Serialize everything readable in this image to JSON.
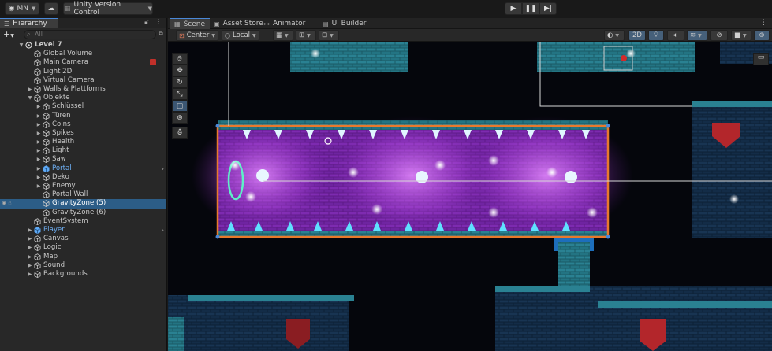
{
  "toolbar": {
    "account": "MN",
    "version_control": "Unity Version Control"
  },
  "hierarchy": {
    "tab_label": "Hierarchy",
    "search_placeholder": "All",
    "items": [
      {
        "label": "Level 7",
        "depth": 0,
        "expanded": true,
        "icon": "unity-scene-icon",
        "bold": true
      },
      {
        "label": "Global Volume",
        "depth": 1,
        "icon": "cube-icon"
      },
      {
        "label": "Main Camera",
        "depth": 1,
        "icon": "cube-icon",
        "badge": "record-icon"
      },
      {
        "label": "Light 2D",
        "depth": 1,
        "icon": "cube-icon"
      },
      {
        "label": "Virtual Camera",
        "depth": 1,
        "icon": "cube-icon"
      },
      {
        "label": "Walls & Plattforms",
        "depth": 1,
        "collapsed": true,
        "icon": "cube-icon"
      },
      {
        "label": "Objekte",
        "depth": 1,
        "expanded": true,
        "icon": "cube-icon"
      },
      {
        "label": "Schlüssel",
        "depth": 2,
        "collapsed": true,
        "icon": "cube-icon"
      },
      {
        "label": "Türen",
        "depth": 2,
        "collapsed": true,
        "icon": "cube-icon"
      },
      {
        "label": "Coins",
        "depth": 2,
        "collapsed": true,
        "icon": "cube-icon"
      },
      {
        "label": "Spikes",
        "depth": 2,
        "collapsed": true,
        "icon": "cube-icon"
      },
      {
        "label": "Health",
        "depth": 2,
        "collapsed": true,
        "icon": "cube-icon"
      },
      {
        "label": "Light",
        "depth": 2,
        "collapsed": true,
        "icon": "cube-icon"
      },
      {
        "label": "Saw",
        "depth": 2,
        "collapsed": true,
        "icon": "cube-icon"
      },
      {
        "label": "Portal",
        "depth": 2,
        "collapsed": true,
        "icon": "prefab-icon",
        "prefab": true
      },
      {
        "label": "Deko",
        "depth": 2,
        "collapsed": true,
        "icon": "cube-icon"
      },
      {
        "label": "Enemy",
        "depth": 2,
        "collapsed": true,
        "icon": "cube-icon"
      },
      {
        "label": "Portal Wall",
        "depth": 2,
        "icon": "cube-icon"
      },
      {
        "label": "GravityZone (5)",
        "depth": 2,
        "icon": "cube-icon",
        "selected": true
      },
      {
        "label": "GravityZone (6)",
        "depth": 2,
        "icon": "cube-icon"
      },
      {
        "label": "EventSystem",
        "depth": 1,
        "icon": "cube-icon"
      },
      {
        "label": "Player",
        "depth": 1,
        "collapsed": true,
        "icon": "prefab-icon",
        "prefab": true
      },
      {
        "label": "Canvas",
        "depth": 1,
        "collapsed": true,
        "icon": "cube-icon"
      },
      {
        "label": "Logic",
        "depth": 1,
        "collapsed": true,
        "icon": "cube-icon"
      },
      {
        "label": "Map",
        "depth": 1,
        "collapsed": true,
        "icon": "cube-icon"
      },
      {
        "label": "Sound",
        "depth": 1,
        "collapsed": true,
        "icon": "cube-icon"
      },
      {
        "label": "Backgrounds",
        "depth": 1,
        "collapsed": true,
        "icon": "cube-icon"
      }
    ]
  },
  "scene_tabs": [
    {
      "label": "Scene",
      "icon": "scene-icon",
      "active": true
    },
    {
      "label": "Asset Store",
      "icon": "asset-store-icon"
    },
    {
      "label": "Animator",
      "icon": "animator-icon"
    },
    {
      "label": "UI Builder",
      "icon": "ui-builder-icon"
    }
  ],
  "scene_toolbar": {
    "pivot": "Center",
    "space": "Local",
    "mode_2d": "2D"
  },
  "colors": {
    "selection": "#2c5d87",
    "accent": "#4a88d8",
    "gravity_zone_border": "#e8792c",
    "gravity_zone_fill": "#a23ed8",
    "tile": "#2a7d8c"
  }
}
